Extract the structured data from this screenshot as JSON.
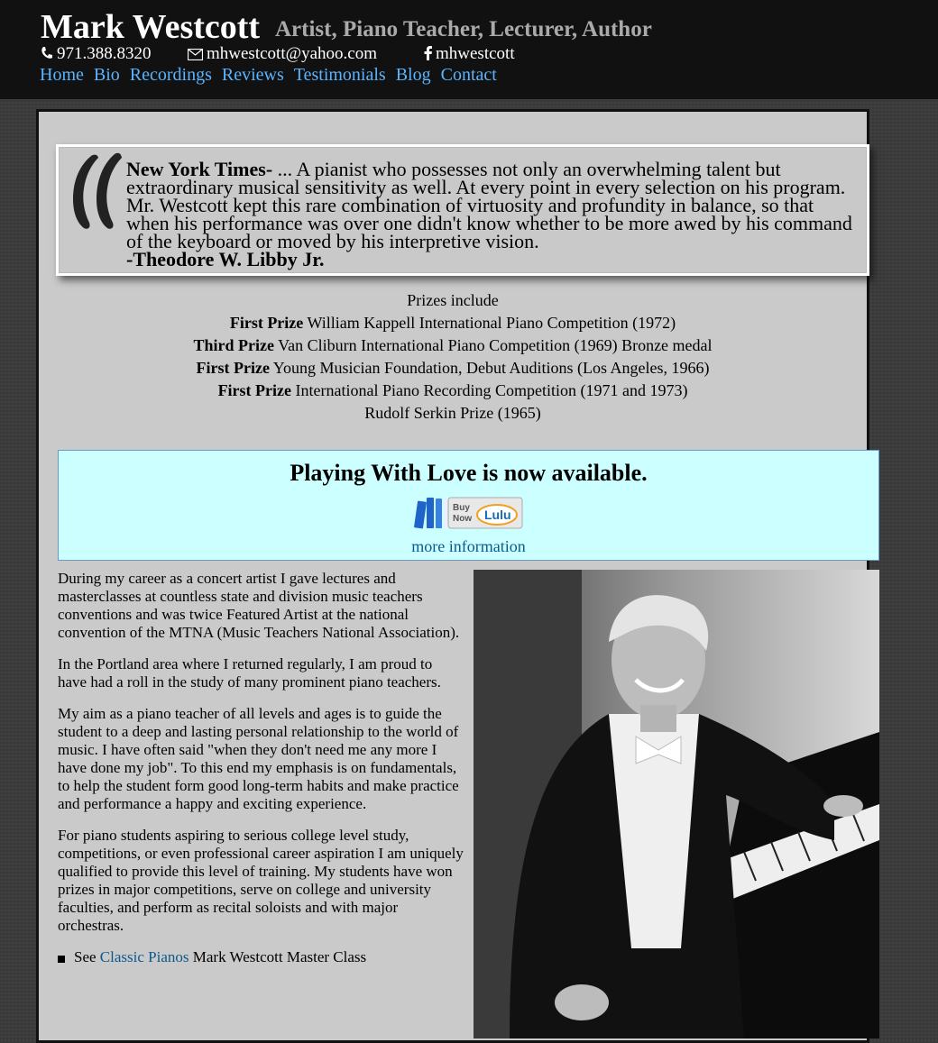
{
  "header": {
    "title": "Mark Westcott",
    "tagline": "Artist, Piano Teacher, Lecturer, Author",
    "phone": "971.388.8320",
    "email": "mhwestcott@yahoo.com",
    "facebook": "mhwestcott"
  },
  "nav": [
    "Home",
    "Bio",
    "Recordings",
    "Reviews",
    "Testimonials",
    "Blog",
    "Contact"
  ],
  "quote": {
    "source": "New York Times-",
    "text": " ... A pianist who possesses not only an overwhelming talent but extraordinary musical sensitivity as well. At every point in every selection on his program. Mr. Westcott kept this rare combination of virtuosity and profundity in balance, so that when his performance was over one didn't know whether to be more awed by his command of the keyboard or moved by his interpretive vision.",
    "author": "-Theodore W. Libby Jr."
  },
  "prizes": {
    "heading": "Prizes include",
    "items": [
      {
        "rank": "First Prize",
        "detail": " William Kappell International Piano Competition (1972)"
      },
      {
        "rank": "Third Prize",
        "detail": " Van Cliburn International Piano Competition (1969) Bronze medal"
      },
      {
        "rank": "First Prize",
        "detail": " Young Musician Foundation, Debut Auditions (Los Angeles, 1966)"
      },
      {
        "rank": "First Prize",
        "detail": " International Piano Recording Competition (1971 and 1973)"
      },
      {
        "rank": "",
        "detail": "Rudolf Serkin Prize (1965)"
      }
    ]
  },
  "book": {
    "headline": "Playing With Love is now available.",
    "buy_label_1": "Buy",
    "buy_label_2": "Now",
    "buy_brand": "Lulu",
    "more_link": "more information"
  },
  "bio": {
    "paragraphs": [
      "During my career as a concert artist I gave lectures and masterclasses at countless state and division music teachers conventions and was twice Featured Artist at the national convention of the MTNA (Music Teachers National Association).",
      "In the Portland area where I returned regularly, I am proud to have had a roll in the study of many prominent piano teachers.",
      "My aim as a piano teacher of all levels and ages is to guide the student to a deep and lasting personal relationship to the world of music. I have often said \"when they don't need me any more I have done my job\". To this end my emphasis is on fundamentals, to help the student form good long-term habits and make practice and performance a happy and exciting experience.",
      "For piano students aspiring to serious college level study, competitions, or even professional career aspiration I am uniquely qualified to provide this level of training. My students have won prizes in major competitions, serve on college and university faculties, and perform as recital soloists and with major orchestras."
    ],
    "list_prefix": "See ",
    "list_link": "Classic Pianos",
    "list_suffix": " Mark Westcott Master Class"
  },
  "colors": {
    "header_bg": "#111111",
    "nav_link": "#5ab4ff",
    "content_bg": "#cacaca",
    "book_box_bg": "#ccffff",
    "link": "#0b5a8e"
  },
  "icons": [
    "phone-icon",
    "envelope-icon",
    "facebook-icon",
    "quote-mark-icon",
    "book-stack-icon",
    "bullet-icon"
  ]
}
